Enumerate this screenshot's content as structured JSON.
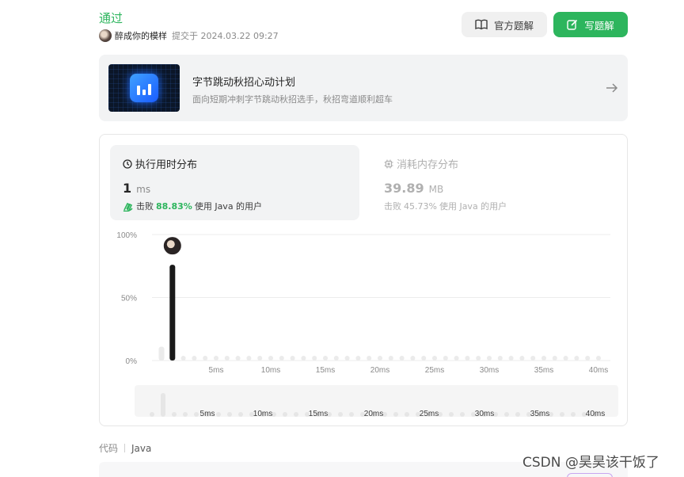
{
  "submission": {
    "status": "通过",
    "username": "醉成你的模样",
    "submitted_text": "提交于 2024.03.22 09:27"
  },
  "actions": {
    "official_solution": "官方题解",
    "write_solution": "写题解"
  },
  "banner": {
    "title": "字节跳动秋招心动计划",
    "subtitle": "面向短期冲刺字节跳动秋招选手，秋招弯道顺利超车"
  },
  "stats": {
    "runtime": {
      "label": "执行用时分布",
      "value": "1",
      "unit": "ms",
      "beat_prefix": "击败",
      "beat_pct": "88.83%",
      "beat_suffix": "使用 Java 的用户"
    },
    "memory": {
      "label": "消耗内存分布",
      "value": "39.89",
      "unit": "MB",
      "beat_prefix": "击败",
      "beat_pct": "45.73%",
      "beat_suffix": "使用 Java 的用户"
    }
  },
  "chart_data": {
    "type": "bar",
    "y_ticks": [
      "100%",
      "50%",
      "0%"
    ],
    "ylim": [
      0,
      100
    ],
    "x_ticks": [
      "5ms",
      "10ms",
      "15ms",
      "20ms",
      "25ms",
      "30ms",
      "35ms",
      "40ms"
    ],
    "xlim": [
      0,
      40
    ],
    "series": [
      {
        "x": [
          0,
          1
        ],
        "values": [
          11,
          76
        ],
        "highlight_index": 1
      }
    ],
    "highlight_color": "#1a1a1a",
    "bar_color": "#ebebeb",
    "minimap_x_ticks": [
      "5ms",
      "10ms",
      "15ms",
      "20ms",
      "25ms",
      "30ms",
      "35ms",
      "40ms"
    ]
  },
  "code": {
    "label": "代码",
    "language": "Java"
  },
  "watermark": "CSDN @昊昊该干饭了",
  "colors": {
    "accent_green": "#2db55d",
    "panel_gray": "#f2f3f4"
  }
}
